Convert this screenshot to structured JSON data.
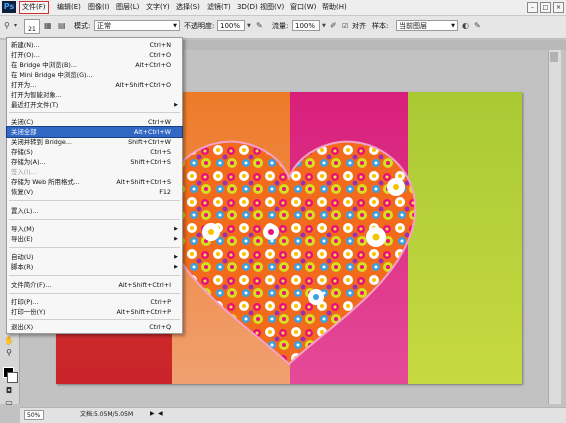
{
  "app": {
    "logo": "Ps"
  },
  "menubar": {
    "items": [
      "文件(F)",
      "编辑(E)",
      "图像(I)",
      "图层(L)",
      "文字(Y)",
      "选择(S)",
      "滤镜(T)",
      "3D(D)",
      "视图(V)",
      "窗口(W)",
      "帮助(H)"
    ],
    "selected": "文件(F)"
  },
  "options": {
    "brush_size": "21",
    "mode_label": "模式:",
    "mode_value": "正常",
    "opacity_label": "不透明度:",
    "opacity_value": "100%",
    "flow_label": "流量:",
    "flow_value": "100%",
    "aligned_label": "对齐",
    "sample_label": "样本:",
    "sample_value": "当前图层"
  },
  "file_menu": {
    "items": [
      {
        "label": "新建(N)...",
        "shortcut": "Ctrl+N"
      },
      {
        "label": "打开(O)...",
        "shortcut": "Ctrl+O"
      },
      {
        "label": "在 Bridge 中浏览(B)...",
        "shortcut": "Alt+Ctrl+O"
      },
      {
        "label": "在 Mini Bridge 中浏览(G)...",
        "shortcut": ""
      },
      {
        "label": "打开为...",
        "shortcut": "Alt+Shift+Ctrl+O"
      },
      {
        "label": "打开为智能对象...",
        "shortcut": ""
      },
      {
        "label": "最近打开文件(T)",
        "shortcut": ""
      },
      {
        "label": "关闭(C)",
        "shortcut": "Ctrl+W"
      },
      {
        "label": "关闭全部",
        "shortcut": "Alt+Ctrl+W"
      },
      {
        "label": "关闭并转到 Bridge...",
        "shortcut": "Shift+Ctrl+W"
      },
      {
        "label": "存储(S)",
        "shortcut": "Ctrl+S"
      },
      {
        "label": "存储为(A)...",
        "shortcut": "Shift+Ctrl+S"
      },
      {
        "label": "签入(I)...",
        "shortcut": ""
      },
      {
        "label": "存储为 Web 所用格式...",
        "shortcut": "Alt+Shift+Ctrl+S"
      },
      {
        "label": "恢复(V)",
        "shortcut": "F12"
      },
      {
        "label": "置入(L)...",
        "shortcut": ""
      },
      {
        "label": "导入(M)",
        "shortcut": ""
      },
      {
        "label": "导出(E)",
        "shortcut": ""
      },
      {
        "label": "自动(U)",
        "shortcut": ""
      },
      {
        "label": "脚本(R)",
        "shortcut": ""
      },
      {
        "label": "文件简介(F)...",
        "shortcut": "Alt+Shift+Ctrl+I"
      },
      {
        "label": "打印(P)...",
        "shortcut": "Ctrl+P"
      },
      {
        "label": "打印一份(Y)",
        "shortcut": "Alt+Shift+Ctrl+P"
      },
      {
        "label": "退出(X)",
        "shortcut": "Ctrl+Q"
      }
    ],
    "highlighted": "关闭全部",
    "disabled": [
      "签入(I)..."
    ]
  },
  "status": {
    "zoom": "50%",
    "doc_info": "文档:5.05M/5.05M"
  },
  "colors": {
    "highlight": "#3168c4",
    "selected_outline": "#d03030",
    "stripes": [
      "#d8302a",
      "#ea7b2c",
      "#d9237a",
      "#a8c833"
    ]
  }
}
